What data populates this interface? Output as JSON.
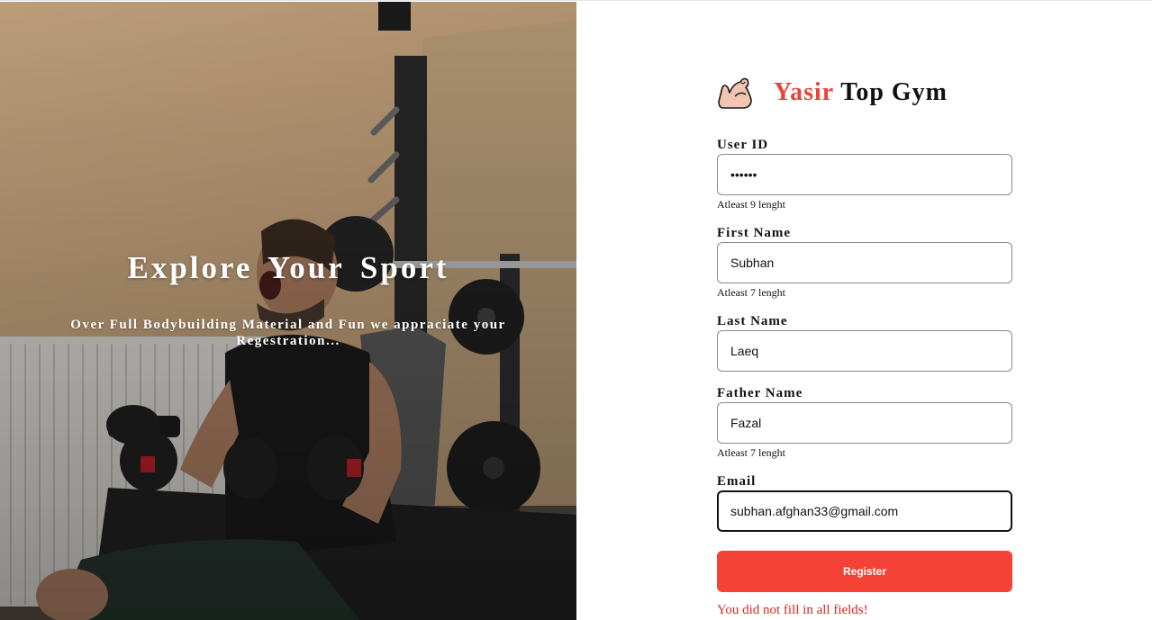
{
  "hero": {
    "title": "Explore Your Sport",
    "subtitle": "Over Full Bodybuilding Material and Fun we appraciate your Regestration..."
  },
  "brand": {
    "logo_icon": "flexed-biceps-icon",
    "name_first": "Yasir",
    "name_rest": " Top Gym",
    "accent_color": "#e8443a"
  },
  "form": {
    "user_id": {
      "label": "User ID",
      "value": "••••••",
      "hint": "Atleast 9 lenght"
    },
    "first_name": {
      "label": "First Name",
      "value": "Subhan",
      "hint": "Atleast 7 lenght"
    },
    "last_name": {
      "label": "Last Name",
      "value": "Laeq"
    },
    "father_name": {
      "label": "Father Name",
      "value": "Fazal",
      "hint": "Atleast 7 lenght"
    },
    "email": {
      "label": "Email",
      "value": "subhan.afghan33@gmail.com"
    },
    "register_label": "Register",
    "button_color": "#f44336",
    "error_message": "You did not fill in all fields!",
    "error_color": "#d9281c"
  }
}
